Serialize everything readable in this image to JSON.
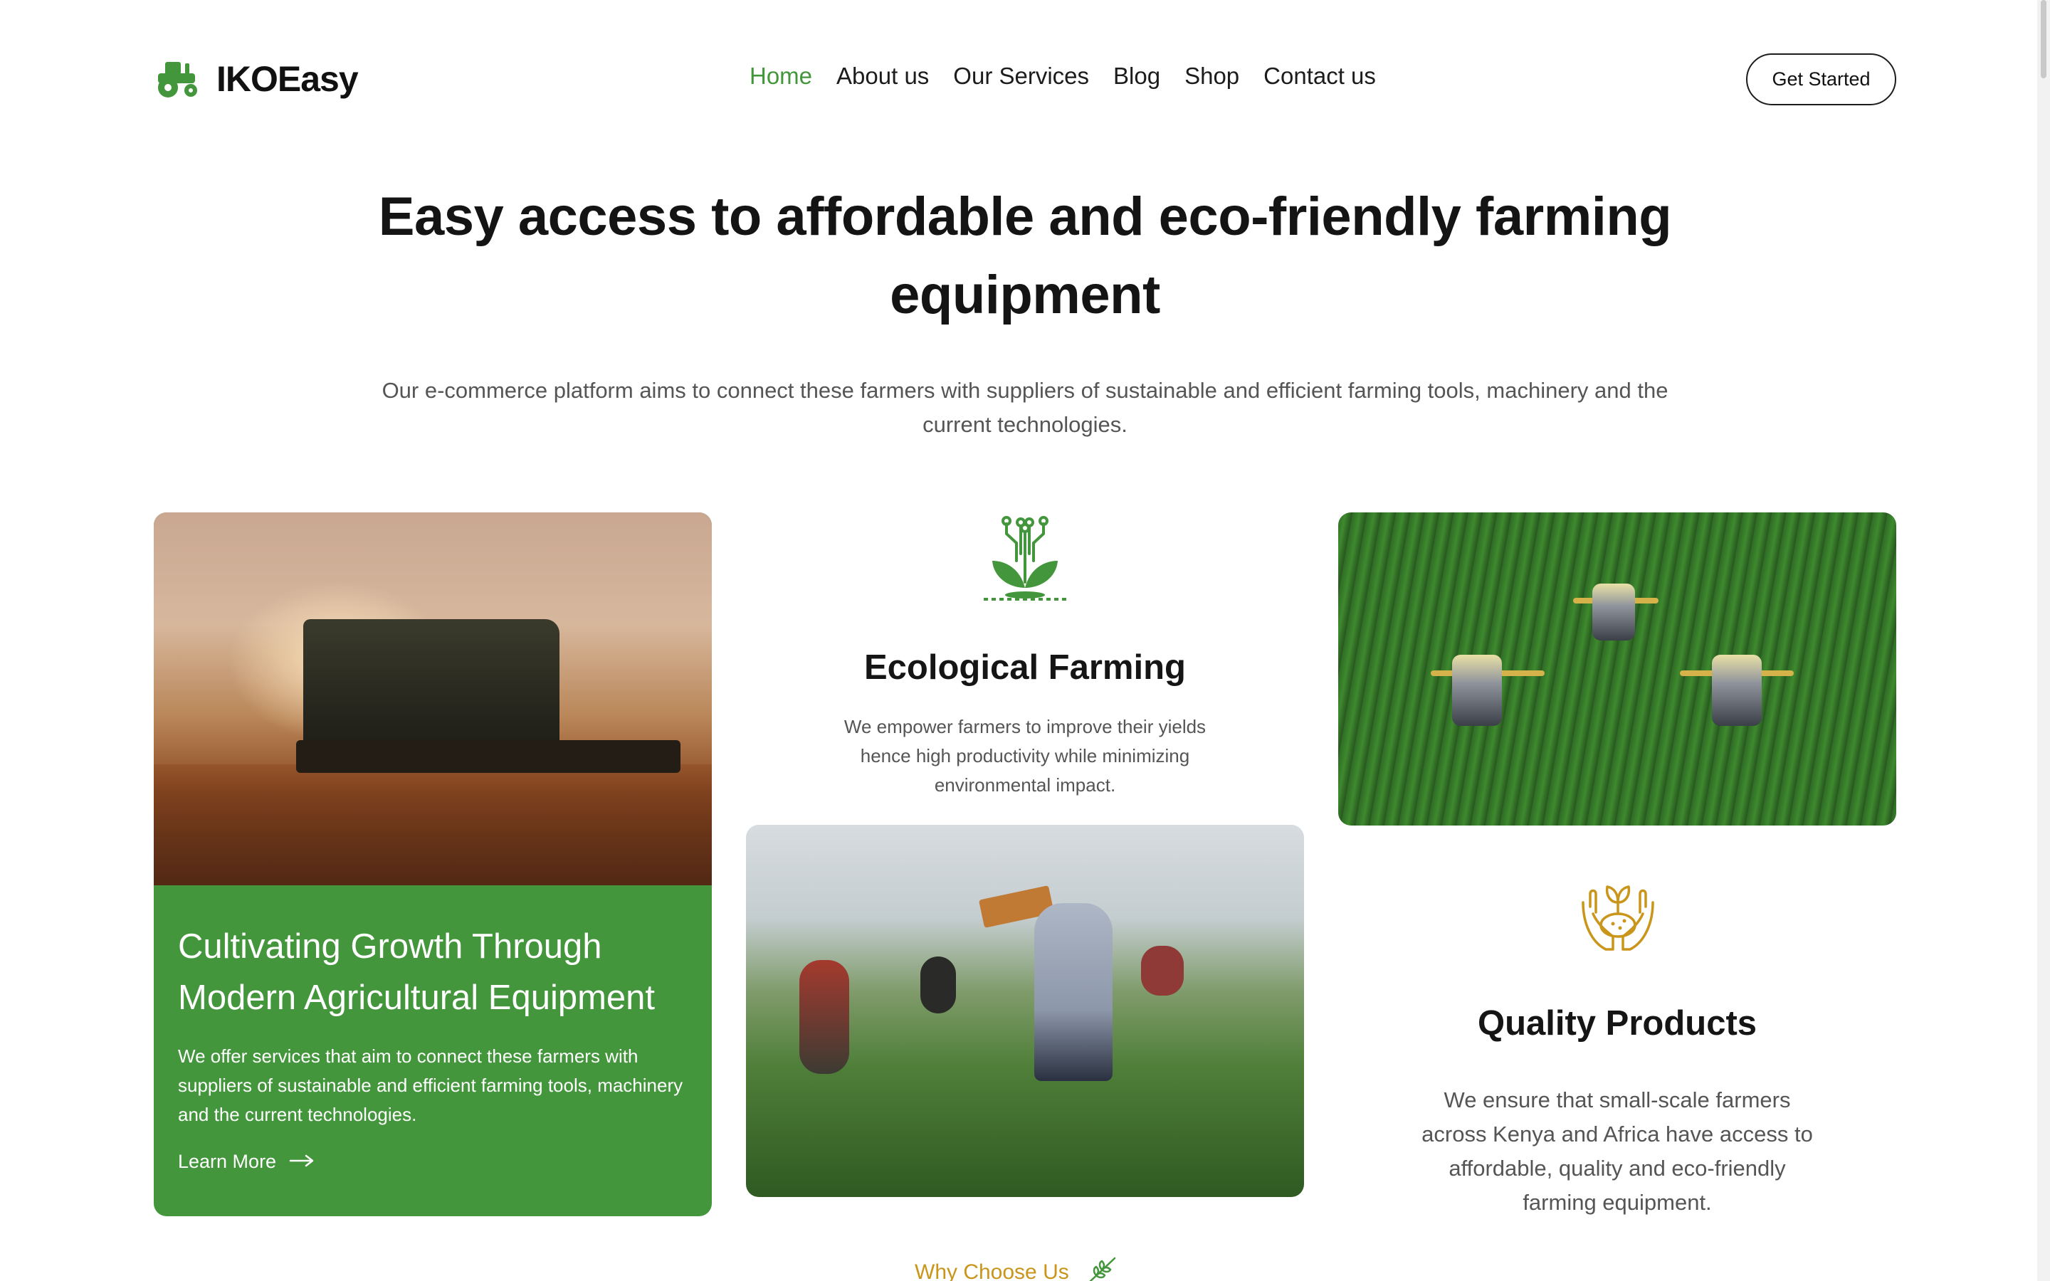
{
  "brand": {
    "name": "IKOEasy",
    "icon": "tractor-icon",
    "color": "#43963c"
  },
  "nav": {
    "items": [
      {
        "label": "Home",
        "active": true
      },
      {
        "label": "About us"
      },
      {
        "label": "Our Services"
      },
      {
        "label": "Blog"
      },
      {
        "label": "Shop"
      },
      {
        "label": "Contact us"
      }
    ],
    "cta_label": "Get Started"
  },
  "hero": {
    "title": "Easy access to affordable and eco-friendly farming equipment",
    "subtitle": "Our e-commerce platform aims to connect these farmers with suppliers of sustainable and efficient farming tools, machinery and the current technologies."
  },
  "cards": {
    "growth": {
      "title": "Cultivating Growth Through Modern Agricultural Equipment",
      "text": "We offer services that aim to connect these farmers with suppliers of sustainable and efficient farming tools, machinery and the current technologies.",
      "link_label": "Learn More",
      "image": "harvester-photo"
    },
    "eco": {
      "title": "Ecological Farming",
      "text": "We empower farmers to improve their yields hence high productivity while minimizing environmental impact.",
      "icon": "plant-circuit-icon"
    },
    "pickers_image": "field-workers-photo",
    "tractors_image": "tractors-aerial-photo",
    "quality": {
      "title": "Quality Products",
      "text": "We ensure that small-scale farmers across Kenya and Africa have access to affordable, quality and eco-friendly farming equipment.",
      "icon": "hands-seedling-icon"
    }
  },
  "why": {
    "label": "Why Choose Us",
    "icon": "wheat-icon",
    "color": "#c9951a"
  },
  "colors": {
    "accent": "#43963c",
    "gold": "#c9951a",
    "text": "#151515",
    "muted": "#555555"
  }
}
